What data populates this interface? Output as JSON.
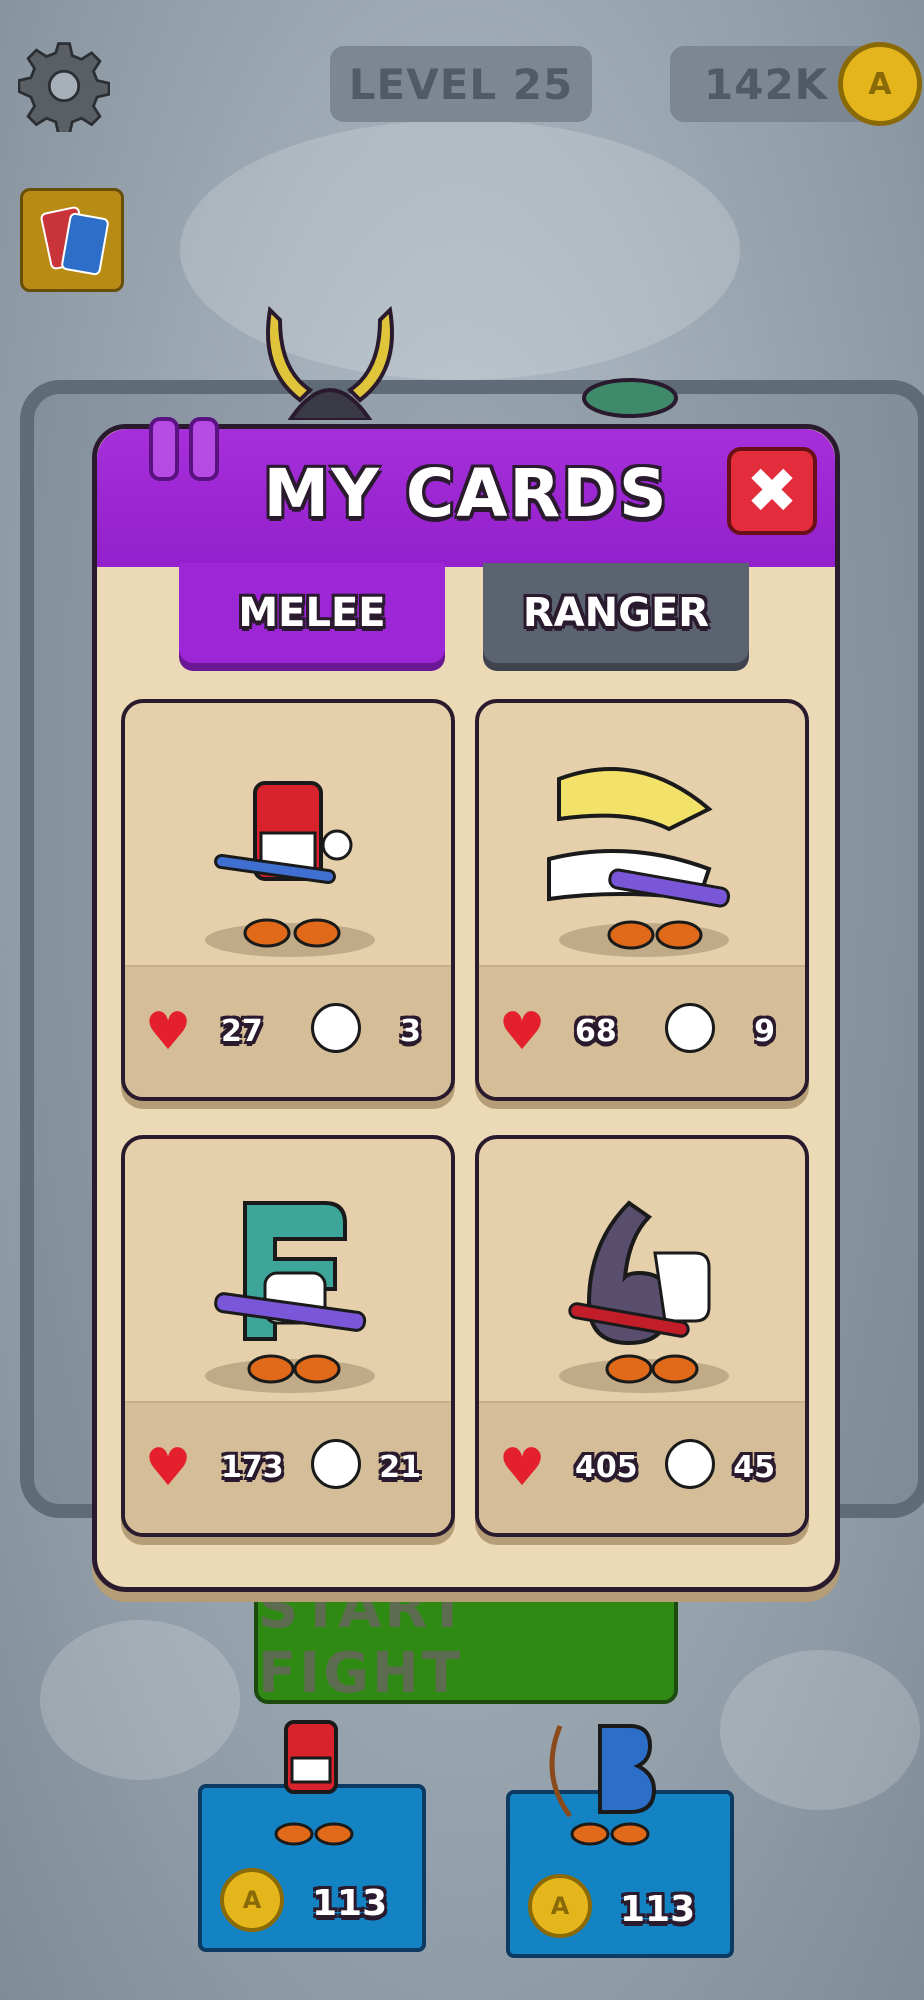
{
  "hud": {
    "level_label": "LEVEL 25",
    "coins": "142K",
    "coin_symbol": "A"
  },
  "background": {
    "start_fight_label": "START FIGHT",
    "shop_cards": [
      {
        "price": "113",
        "coin_symbol": "A"
      },
      {
        "price": "113",
        "coin_symbol": "A"
      }
    ]
  },
  "modal": {
    "title": "MY CARDS",
    "close_symbol": "✖",
    "tabs": [
      {
        "label": "MELEE",
        "active": true
      },
      {
        "label": "RANGER",
        "active": false
      }
    ],
    "cards": [
      {
        "character": "letter-A",
        "health": "27",
        "attack": "3",
        "color": "#d8222c"
      },
      {
        "character": "letter-B",
        "health": "68",
        "attack": "9",
        "color": "#f2e26a"
      },
      {
        "character": "letter-C",
        "health": "173",
        "attack": "21",
        "color": "#3ea59a"
      },
      {
        "character": "letter-D",
        "health": "405",
        "attack": "45",
        "color": "#5a4e6e"
      }
    ]
  },
  "colors": {
    "header_purple": "#a62fd9",
    "active_tab": "#9d26d6",
    "inactive_tab": "#5c6370",
    "close_red": "#e32c3c",
    "coin_gold": "#e5b61c"
  }
}
